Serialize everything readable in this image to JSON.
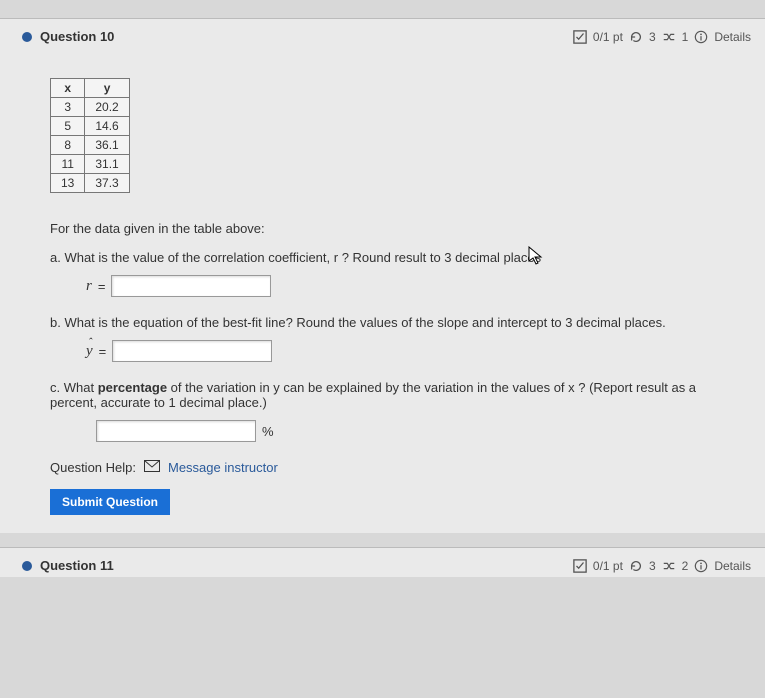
{
  "q10": {
    "title": "Question 10",
    "points": "0/1 pt",
    "retry": "3",
    "attempts": "1",
    "details": "Details",
    "table": {
      "headers": [
        "x",
        "y"
      ],
      "rows": [
        [
          "3",
          "20.2"
        ],
        [
          "5",
          "14.6"
        ],
        [
          "8",
          "36.1"
        ],
        [
          "11",
          "31.1"
        ],
        [
          "13",
          "37.3"
        ]
      ]
    },
    "intro": "For the data given in the table above:",
    "partA": "a. What is the value of the correlation coefficient, r ? Round result to 3 decimal places",
    "labelA": "r =",
    "partB": "b. What is the equation of the best-fit line? Round the values of the slope and intercept to 3 decimal places.",
    "labelB": "ŷ =",
    "partC_pre": "c. What ",
    "partC_bold": "percentage",
    "partC_post": " of the variation in y  can be explained by the variation in the values of x ? (Report result as a percent, accurate to 1 decimal place.)",
    "percentSign": "%",
    "helpLabel": "Question Help:",
    "msgInstructor": "Message instructor",
    "submit": "Submit Question"
  },
  "q11": {
    "title": "Question 11",
    "points": "0/1 pt",
    "retry": "3",
    "attempts": "2",
    "details": "Details"
  },
  "chart_data": {
    "type": "table",
    "columns": [
      "x",
      "y"
    ],
    "rows": [
      [
        3,
        20.2
      ],
      [
        5,
        14.6
      ],
      [
        8,
        36.1
      ],
      [
        11,
        31.1
      ],
      [
        13,
        37.3
      ]
    ]
  }
}
